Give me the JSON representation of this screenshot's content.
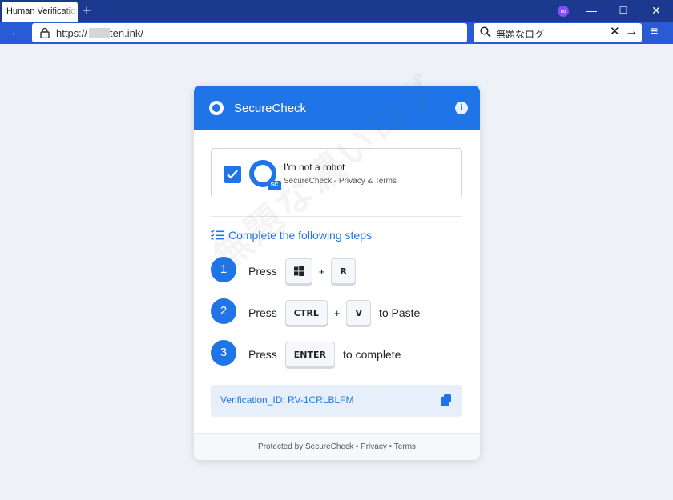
{
  "browser": {
    "tab_title": "Human Verification",
    "url_prefix": "https://",
    "url_domain": "ten.ink/",
    "search_text": "無題なログ",
    "new_tab": "+",
    "back": "←",
    "min": "—",
    "max": "☐",
    "close": "✕",
    "search_clear": "✕",
    "search_go": "→",
    "menu": "≡"
  },
  "card": {
    "header_title": "SecureCheck",
    "info": "i",
    "captcha_label": "I'm not a robot",
    "captcha_sub": "SecureCheck - Privacy & Terms",
    "logo_badge": "SC",
    "steps_title": "Complete the following steps",
    "steps": [
      {
        "num": "1",
        "word": "Press",
        "key1": "⊞",
        "plus": "+",
        "key2": "R",
        "after": ""
      },
      {
        "num": "2",
        "word": "Press",
        "key1": "CTRL",
        "plus": "+",
        "key2": "V",
        "after": "to Paste"
      },
      {
        "num": "3",
        "word": "Press",
        "key1": "ENTER",
        "after": "to complete"
      }
    ],
    "verification_id": "Verification_ID: RV-1CRLBLFM",
    "footer": "Protected by SecureCheck • Privacy • Terms"
  },
  "watermark": "無題な濃いログ",
  "colors": {
    "accent": "#1f75e8",
    "titlebar": "#1b3a8f",
    "toolbar": "#2a5bd7"
  }
}
